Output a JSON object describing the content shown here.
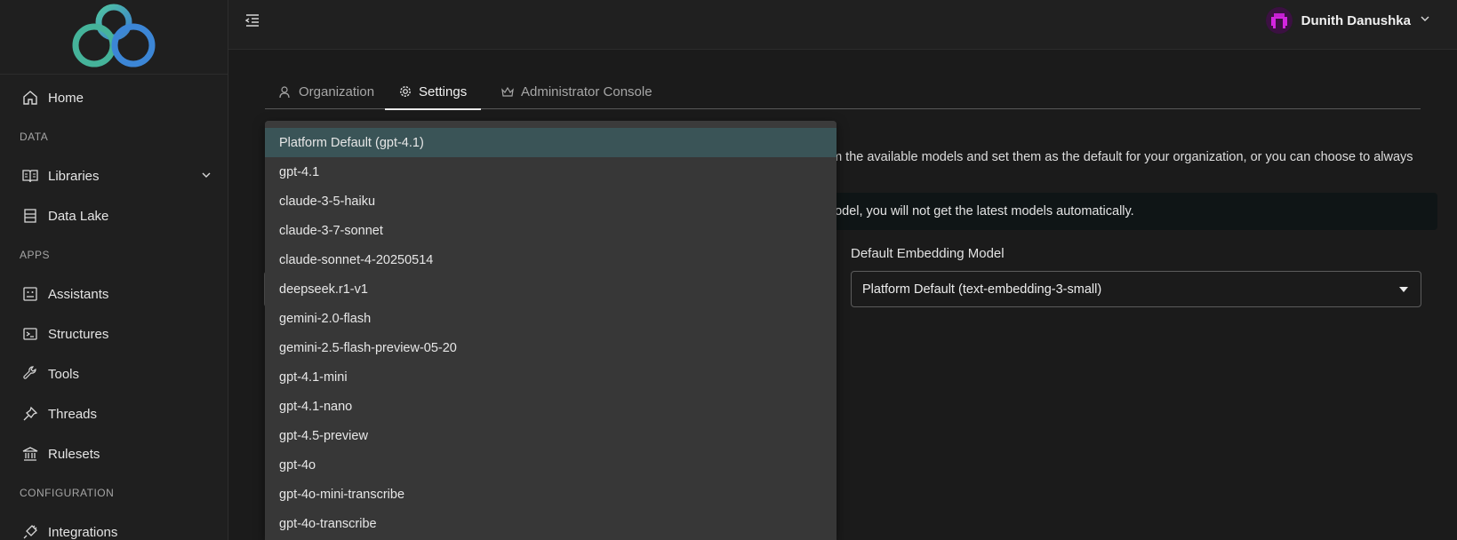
{
  "sidebar": {
    "items": [
      {
        "label": "Home",
        "icon": "home-icon"
      },
      {
        "label": "Libraries",
        "icon": "book-icon"
      },
      {
        "label": "Data Lake",
        "icon": "database-icon"
      },
      {
        "label": "Assistants",
        "icon": "assistant-icon"
      },
      {
        "label": "Structures",
        "icon": "terminal-icon"
      },
      {
        "label": "Tools",
        "icon": "wrench-icon"
      },
      {
        "label": "Threads",
        "icon": "pin-icon"
      },
      {
        "label": "Rulesets",
        "icon": "bank-icon"
      },
      {
        "label": "Integrations",
        "icon": "plug-icon"
      }
    ],
    "sections": {
      "data": "DATA",
      "apps": "APPS",
      "configuration": "CONFIGURATION"
    }
  },
  "topbar": {
    "user_name": "Dunith Danushka"
  },
  "tabs": [
    {
      "label": "Organization",
      "icon": "person-icon"
    },
    {
      "label": "Settings",
      "icon": "gear-icon"
    },
    {
      "label": "Administrator Console",
      "icon": "crown-icon"
    }
  ],
  "content": {
    "description_line1": "om the available models and set them as the default for your organization, or you can choose to always",
    "alert_text": "model, you will not get the latest models automatically.",
    "embedding_label": "Default Embedding Model",
    "embedding_value": "Platform Default (text-embedding-3-small)"
  },
  "dropdown": {
    "selected": "Platform Default (gpt-4.1)",
    "options": [
      "Platform Default (gpt-4.1)",
      "gpt-4.1",
      "claude-3-5-haiku",
      "claude-3-7-sonnet",
      "claude-sonnet-4-20250514",
      "deepseek.r1-v1",
      "gemini-2.0-flash",
      "gemini-2.5-flash-preview-05-20",
      "gpt-4.1-mini",
      "gpt-4.1-nano",
      "gpt-4.5-preview",
      "gpt-4o",
      "gpt-4o-mini-transcribe",
      "gpt-4o-transcribe"
    ]
  },
  "colors": {
    "accent_selected": "#3a5457",
    "logo_teal": "#3fb6a8",
    "logo_blue": "#3c7fd1"
  }
}
